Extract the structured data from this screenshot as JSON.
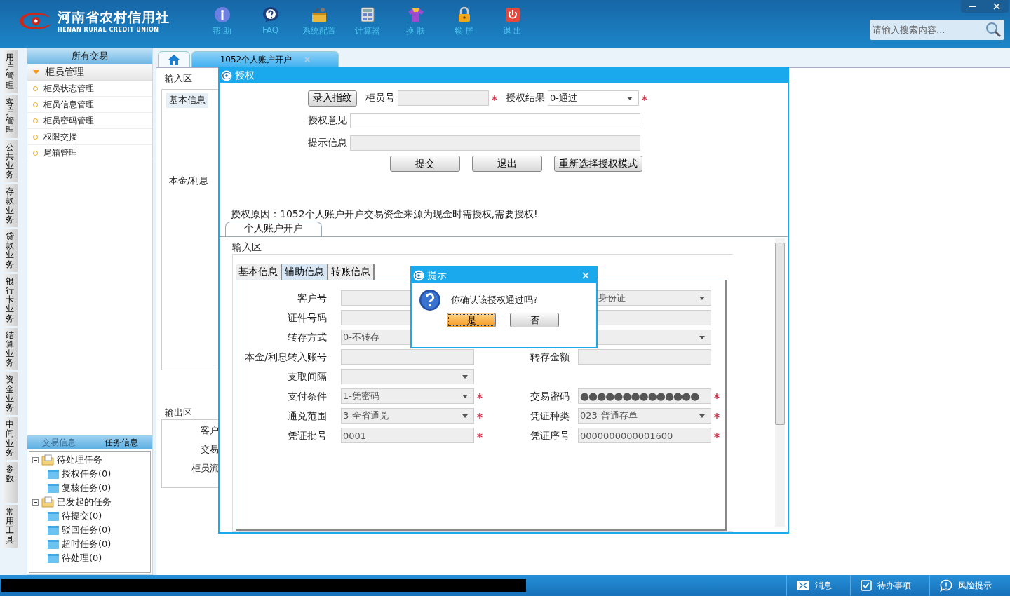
{
  "header": {
    "logo_cn": "河南省农村信用社",
    "logo_en": "HENAN RURAL CREDIT UNION",
    "toolbar": [
      {
        "kind": "info",
        "label": "帮 助"
      },
      {
        "kind": "faq",
        "label": "FAQ"
      },
      {
        "kind": "config",
        "label": "系统配置"
      },
      {
        "kind": "calculator",
        "label": "计算器"
      },
      {
        "kind": "skin",
        "label": "换 肤"
      },
      {
        "kind": "lock",
        "label": "锁 屏"
      },
      {
        "kind": "exit",
        "label": "退 出"
      }
    ],
    "search": {
      "placeholder": "请输入搜索内容..."
    }
  },
  "left_tabs": [
    "用户管理",
    "客户管理",
    "公共业务",
    "存款业务",
    "贷款业务",
    "银行卡业务",
    "结算业务",
    "资金业务",
    "中间业务",
    "参数",
    "常用工具"
  ],
  "sidebar": {
    "title": "所有交易",
    "group": {
      "label": "柜员管理",
      "expanded": true
    },
    "items": [
      "柜员状态管理",
      "柜员信息管理",
      "柜员密码管理",
      "权限交接",
      "尾箱管理"
    ]
  },
  "task_panel": {
    "tabs": [
      {
        "label": "交易信息",
        "selected": false
      },
      {
        "label": "任务信息",
        "selected": true
      }
    ],
    "tree": [
      {
        "label": "待处理任务",
        "expanded": true,
        "children": [
          {
            "label": "授权任务(0)"
          },
          {
            "label": "复核任务(0)"
          }
        ]
      },
      {
        "label": "已发起的任务",
        "expanded": true,
        "children": [
          {
            "label": "待提交(0)"
          },
          {
            "label": "驳回任务(0)"
          },
          {
            "label": "超时任务(0)"
          },
          {
            "label": "待处理(0)"
          }
        ]
      }
    ]
  },
  "main_tabs": [
    {
      "kind": "home",
      "selected": false
    },
    {
      "kind": "page",
      "label": "1052个人账户开户",
      "selected": true
    }
  ],
  "background_form": {
    "input_section": "输入区",
    "tab": "基本信息",
    "label": "本金/利息",
    "output_section": "输出区",
    "output_labels": [
      "客户",
      "交易",
      "柜员流"
    ]
  },
  "auth_dialog": {
    "title": "授权",
    "fingerprint_button": "录入指纹",
    "teller_label": "柜员号",
    "teller_required": true,
    "result_label": "授权结果",
    "result_required": true,
    "result_value": "0-通过",
    "opinion_label": "授权意见",
    "hint_label": "提示信息",
    "buttons": [
      "提交",
      "退出",
      "重新选择授权模式"
    ],
    "reason": "授权原因：1052个人账户开户交易资金来源为现金时需授权,需要授权!",
    "form_tab": "个人账户开户",
    "section": "输入区",
    "tabs": [
      {
        "label": "基本信息",
        "selected": false
      },
      {
        "label": "辅助信息",
        "selected": true
      },
      {
        "label": "转账信息",
        "selected": false
      }
    ],
    "rows": [
      {
        "left": {
          "label": "客户号",
          "kind": "text",
          "required": false
        },
        "right": {
          "kind": "select",
          "value": "身份证",
          "required": false,
          "covered": true
        }
      },
      {
        "left": {
          "label": "证件号码",
          "kind": "text",
          "required": false
        },
        "right": {
          "kind": "text",
          "required": false,
          "covered": true
        }
      },
      {
        "left": {
          "label": "转存方式",
          "kind": "select",
          "value": "0-不转存",
          "required": false
        },
        "right": {
          "kind": "select",
          "required": false,
          "covered": true
        }
      },
      {
        "left": {
          "label": "本金/利息转入账号",
          "kind": "text",
          "required": false
        },
        "right": {
          "label": "转存金额",
          "kind": "text",
          "required": false
        }
      },
      {
        "left": {
          "label": "支取间隔",
          "kind": "select",
          "required": false
        }
      },
      {
        "left": {
          "label": "支付条件",
          "kind": "select",
          "value": "1-凭密码",
          "required": true
        },
        "right": {
          "label": "交易密码",
          "kind": "password",
          "value": "●●●●●●●●●●●●●●",
          "required": true
        }
      },
      {
        "left": {
          "label": "通兑范围",
          "kind": "select",
          "value": "3-全省通兑",
          "required": true
        },
        "right": {
          "label": "凭证种类",
          "kind": "select",
          "value": "023-普通存单",
          "required": true
        }
      },
      {
        "left": {
          "label": "凭证批号",
          "kind": "text",
          "value": "0001",
          "required": true
        },
        "right": {
          "label": "凭证序号",
          "kind": "text",
          "value": "0000000000001600",
          "required": true
        }
      }
    ]
  },
  "confirm_dialog": {
    "title": "提示",
    "message": "你确认该授权通过吗?",
    "buttons": [
      {
        "label": "是",
        "selected": true
      },
      {
        "label": "否",
        "selected": false
      }
    ]
  },
  "status_bar": {
    "items": [
      {
        "kind": "message",
        "label": "消息"
      },
      {
        "kind": "todo",
        "label": "待办事项"
      },
      {
        "kind": "risk",
        "label": "风险提示"
      }
    ]
  }
}
